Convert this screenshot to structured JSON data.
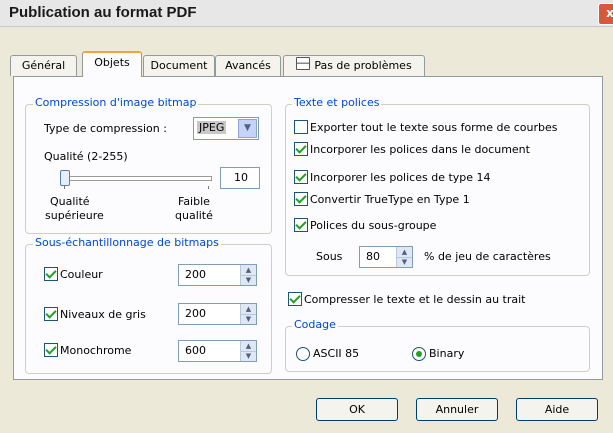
{
  "window": {
    "title": "Publication au format PDF",
    "close_symbol": "x"
  },
  "tabs": [
    {
      "label": "Général"
    },
    {
      "label": "Objets",
      "selected": true
    },
    {
      "label": "Document"
    },
    {
      "label": "Avancés"
    },
    {
      "label": "Pas de problèmes",
      "icon": "checklist-icon"
    }
  ],
  "compression": {
    "title": "Compression d'image bitmap",
    "type_label": "Type de compression :",
    "type_value": "JPEG",
    "quality_label": "Qualité (2-255)",
    "quality_value": "10",
    "slider_left_label_1": "Qualité",
    "slider_left_label_2": "supérieure",
    "slider_right_label_1": "Faible",
    "slider_right_label_2": "qualité"
  },
  "resampling": {
    "title": "Sous-échantillonnage de bitmaps",
    "items": [
      {
        "label": "Couleur",
        "checked": true,
        "value": "200"
      },
      {
        "label": "Niveaux de gris",
        "checked": true,
        "value": "200"
      },
      {
        "label": "Monochrome",
        "checked": true,
        "value": "600"
      }
    ]
  },
  "text_fonts": {
    "title": "Texte et polices",
    "options": [
      {
        "label": "Exporter tout le texte sous forme de courbes",
        "checked": false
      },
      {
        "label": "Incorporer les polices dans le document",
        "checked": true
      },
      {
        "label": "Incorporer les polices de type 14",
        "checked": true
      },
      {
        "label": "Convertir TrueType en Type 1",
        "checked": true
      },
      {
        "label": "Polices du sous-groupe",
        "checked": true
      }
    ],
    "subset_prefix": "Sous",
    "subset_value": "80",
    "subset_suffix": "% de jeu de caractères"
  },
  "compress_text": {
    "label": "Compresser le texte et le dessin au trait",
    "checked": true
  },
  "encoding": {
    "title": "Codage",
    "options": [
      {
        "label": "ASCII 85",
        "selected": false
      },
      {
        "label": "Binary",
        "selected": true
      }
    ]
  },
  "buttons": {
    "ok": "OK",
    "cancel": "Annuler",
    "help": "Aide"
  }
}
